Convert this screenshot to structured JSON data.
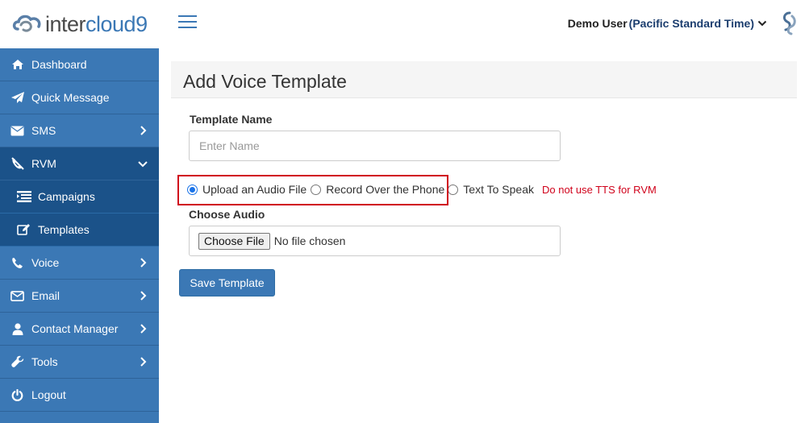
{
  "brand": {
    "logo_text_a": "inter",
    "logo_text_b": "cloud9",
    "accent_color": "#3b78b5",
    "sidebar_active_color": "#1b5289"
  },
  "topbar": {
    "user_name": "Demo User",
    "timezone": "(Pacific Standard Time)"
  },
  "sidebar": {
    "items": [
      {
        "label": "Dashboard",
        "icon": "home-icon"
      },
      {
        "label": "Quick Message",
        "icon": "paper-plane-icon"
      },
      {
        "label": "SMS",
        "icon": "envelope-icon"
      },
      {
        "label": "RVM",
        "icon": "phone-slash-icon"
      },
      {
        "label": "Campaigns",
        "icon": "list-icon"
      },
      {
        "label": "Templates",
        "icon": "edit-icon"
      },
      {
        "label": "Voice",
        "icon": "phone-icon"
      },
      {
        "label": "Email",
        "icon": "envelope-outline-icon"
      },
      {
        "label": "Contact Manager",
        "icon": "user-icon"
      },
      {
        "label": "Tools",
        "icon": "wrench-icon"
      },
      {
        "label": "Logout",
        "icon": "power-icon"
      }
    ]
  },
  "page": {
    "title": "Add Voice Template"
  },
  "form": {
    "template_name_label": "Template Name",
    "template_name_placeholder": "Enter Name",
    "template_name_value": "",
    "audio_options": [
      {
        "label": "Upload an Audio File",
        "checked": true
      },
      {
        "label": "Record Over the Phone",
        "checked": false
      },
      {
        "label": "Text To Speak",
        "checked": false
      }
    ],
    "tts_warning": "Do not use TTS for RVM",
    "choose_audio_label": "Choose Audio",
    "choose_file_button": "Choose File",
    "file_status": "No file chosen",
    "save_button": "Save Template"
  }
}
